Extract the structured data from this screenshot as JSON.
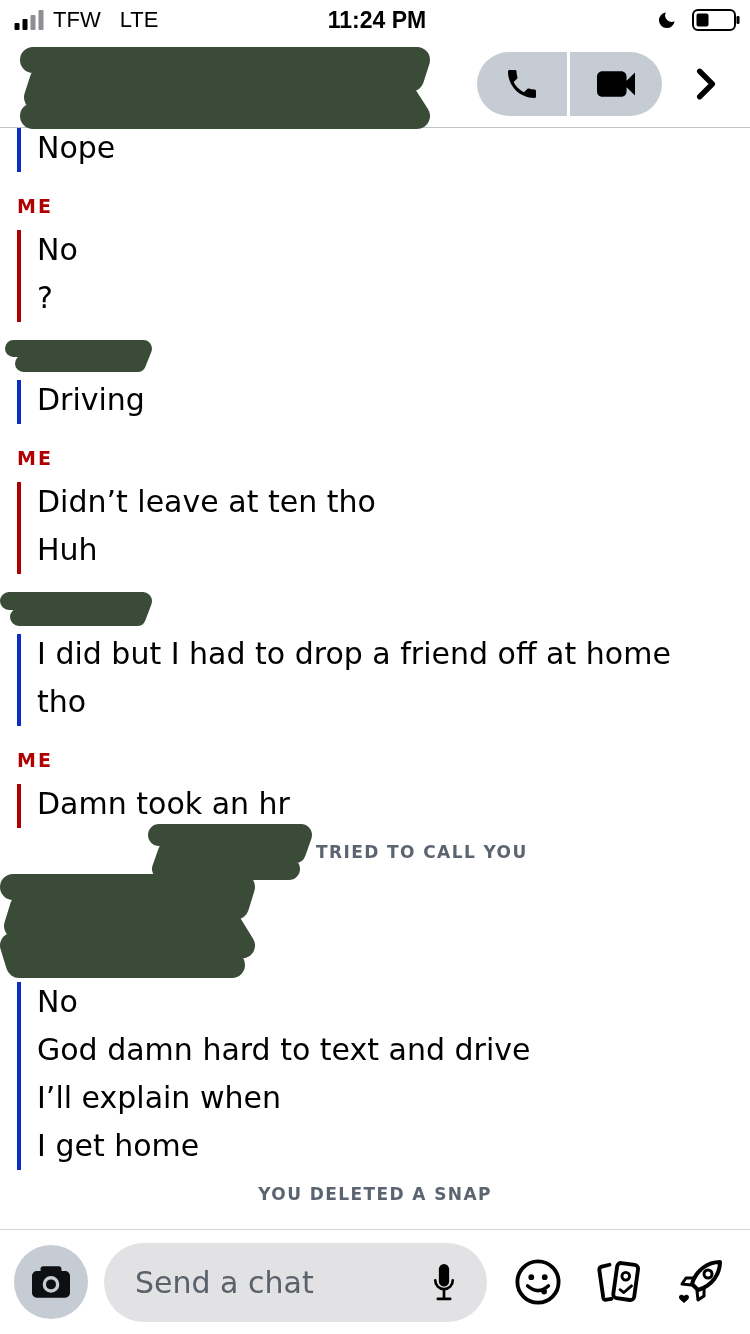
{
  "status_bar": {
    "carrier": "TFW",
    "network": "LTE",
    "time": "11:24 PM"
  },
  "header": {
    "name_redacted": true
  },
  "conversation": [
    {
      "kind": "friend",
      "lines": [
        "Nope"
      ]
    },
    {
      "kind": "me",
      "sender": "ME",
      "lines": [
        "No",
        "?"
      ]
    },
    {
      "kind": "friend",
      "sender_redacted": true,
      "lines": [
        "Driving"
      ]
    },
    {
      "kind": "me",
      "sender": "ME",
      "lines": [
        "Didn’t leave at ten tho",
        "Huh"
      ]
    },
    {
      "kind": "friend",
      "sender_redacted": true,
      "lines": [
        "I did but I had to drop a friend off at home tho"
      ]
    },
    {
      "kind": "me",
      "sender": "ME",
      "lines": [
        "Damn took an hr"
      ]
    },
    {
      "kind": "notice",
      "name_redacted": true,
      "text": "TRIED TO CALL YOU"
    },
    {
      "kind": "friend",
      "sender_redacted": true,
      "lines": [
        "No",
        "God damn hard to text and drive",
        "I’ll explain when",
        "I get home"
      ]
    },
    {
      "kind": "notice",
      "text": "YOU DELETED A SNAP"
    }
  ],
  "composer": {
    "placeholder": "Send a chat"
  }
}
